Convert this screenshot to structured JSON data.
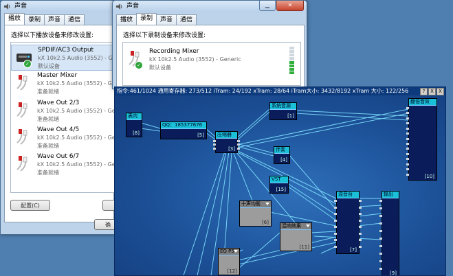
{
  "playback_window": {
    "title": "声音",
    "tabs": [
      "播放",
      "录制",
      "声音",
      "通信"
    ],
    "active_tab": 0,
    "prompt": "选择以下播放设备来修改设置:",
    "devices": [
      {
        "name": "SPDIF/AC3 Output",
        "driver": "kX 10k2.5 Audio (3552) - Generic",
        "status": "默认设备",
        "default": true,
        "selected": true
      },
      {
        "name": "Master Mixer",
        "driver": "kX 10k2.5 Audio (3552) - Generic",
        "status": "准备就绪",
        "default": false
      },
      {
        "name": "Wave Out 2/3",
        "driver": "kX 10k2.5 Audio (3552) - Generic",
        "status": "准备就绪",
        "default": false
      },
      {
        "name": "Wave Out 4/5",
        "driver": "kX 10k2.5 Audio (3552) - Generic",
        "status": "准备就绪",
        "default": false
      },
      {
        "name": "Wave Out 6/7",
        "driver": "kX 10k2.5 Audio (3552) - Generic",
        "status": "准备就绪",
        "default": false
      }
    ],
    "configure_label": "配置(C)",
    "ok_label": "确"
  },
  "record_window": {
    "title": "声音",
    "tabs": [
      "播放",
      "录制",
      "声音",
      "通信"
    ],
    "active_tab": 1,
    "prompt": "选择以下录制设备来修改设置:",
    "devices": [
      {
        "name": "Recording Mixer",
        "driver": "kX 10k2.5 Audio (3552) - Generic",
        "status": "默认设备",
        "default": true,
        "level_segments_on": 4
      }
    ]
  },
  "dsp_window": {
    "title": "指令:461/1024 通用寄存器: 273/512 iTram: 24/192 xTram: 28/64 iTram大小: 3432/8192 xTram 大小: 122/256",
    "title_buttons": [
      "?",
      "X",
      "X"
    ],
    "modules": [
      {
        "id": "m_epilog",
        "name": "表内",
        "num": "[8]",
        "style": "cyan"
      },
      {
        "id": "m_qq",
        "name": "QQ：185377676",
        "num": "[5]",
        "style": "cyan"
      },
      {
        "id": "m_comp",
        "name": "压缩器",
        "num": "[3]",
        "style": "cyan"
      },
      {
        "id": "m_sys",
        "name": "系统音源",
        "num": "[1]",
        "style": "cyan"
      },
      {
        "id": "m_tone",
        "name": "伴奏",
        "num": "[4]",
        "style": "cyan"
      },
      {
        "id": "m_vst",
        "name": "VST",
        "num": "[15]",
        "style": "cyan"
      },
      {
        "id": "m_eq10",
        "name": "十声均衡",
        "num": "[6]",
        "style": "gray"
      },
      {
        "id": "m_reverb",
        "name": "混响效果",
        "num": "[11]",
        "style": "gray"
      },
      {
        "id": "m_eqp5",
        "name": "EQ P5",
        "num": "[12]",
        "style": "gray"
      },
      {
        "id": "m_mixer",
        "name": "混音台",
        "num": "[7]",
        "style": "cyan"
      },
      {
        "id": "m_out",
        "name": "输出",
        "num": "[9]",
        "style": "cyan"
      },
      {
        "id": "m_dsp",
        "name": "翻倍音效",
        "num": "[10]",
        "style": "cyan"
      }
    ]
  },
  "colors": {
    "wire": "#7fe2ff",
    "dsp_bg": "#1f57a0",
    "module_body": "#0a1d5a",
    "default_check": "#2fa43a"
  }
}
